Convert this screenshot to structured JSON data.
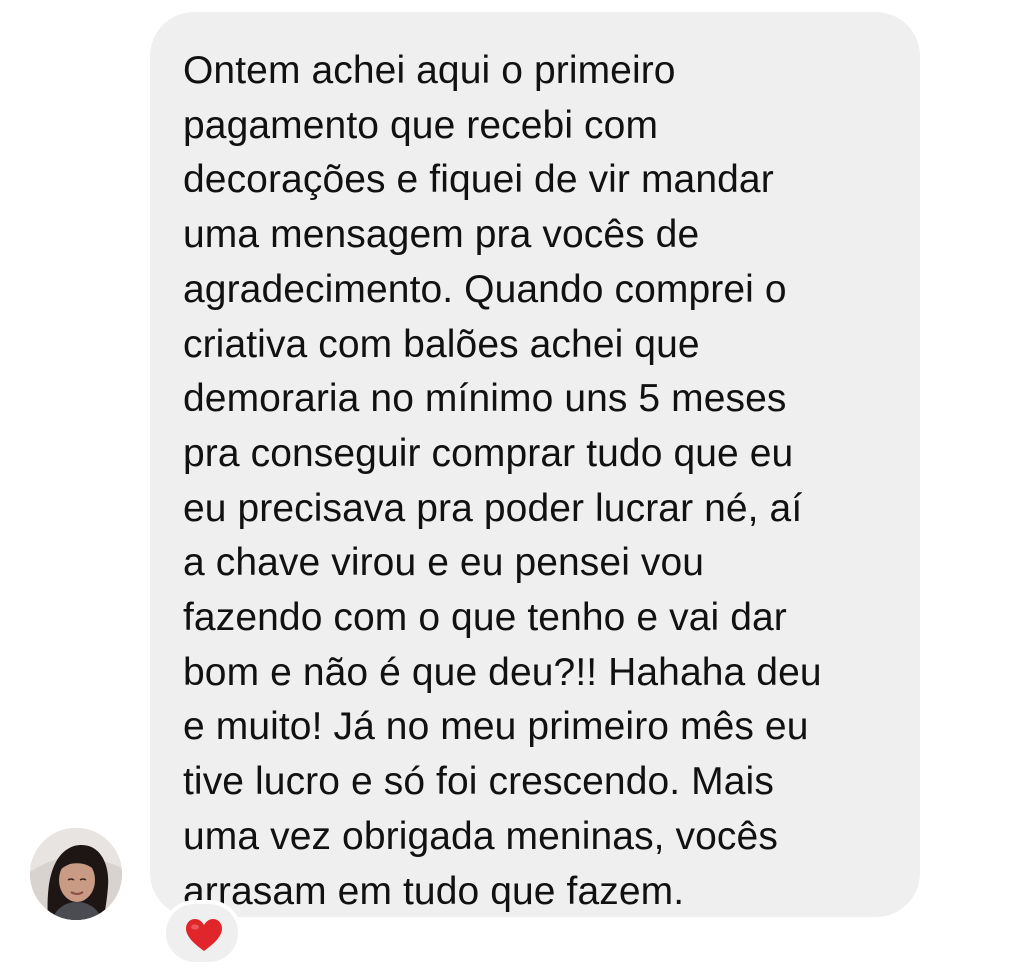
{
  "message": {
    "lines": [
      "Ontem achei aqui o primeiro",
      "pagamento que recebi com",
      "decorações e fiquei de vir mandar",
      "uma mensagem pra vocês de",
      "agradecimento. Quando comprei o",
      "criativa com balões achei que",
      "demoraria no mínimo uns 5 meses",
      "pra conseguir comprar tudo que eu",
      "eu precisava pra poder lucrar né, aí",
      "a chave virou e eu pensei vou",
      "fazendo com o que tenho e vai dar",
      "bom e não é que deu?!! Hahaha deu",
      "e muito! Já no meu primeiro mês eu",
      "tive lucro e só foi crescendo. Mais",
      "uma vez obrigada meninas, vocês",
      "arrasam em tudo que fazem."
    ],
    "bubble_color": "#efeff0",
    "text_color": "#111111"
  },
  "sender": {
    "avatar_icon": "user-photo-avatar"
  },
  "reaction": {
    "icon": "red-heart-icon",
    "color": "#e0252b"
  }
}
